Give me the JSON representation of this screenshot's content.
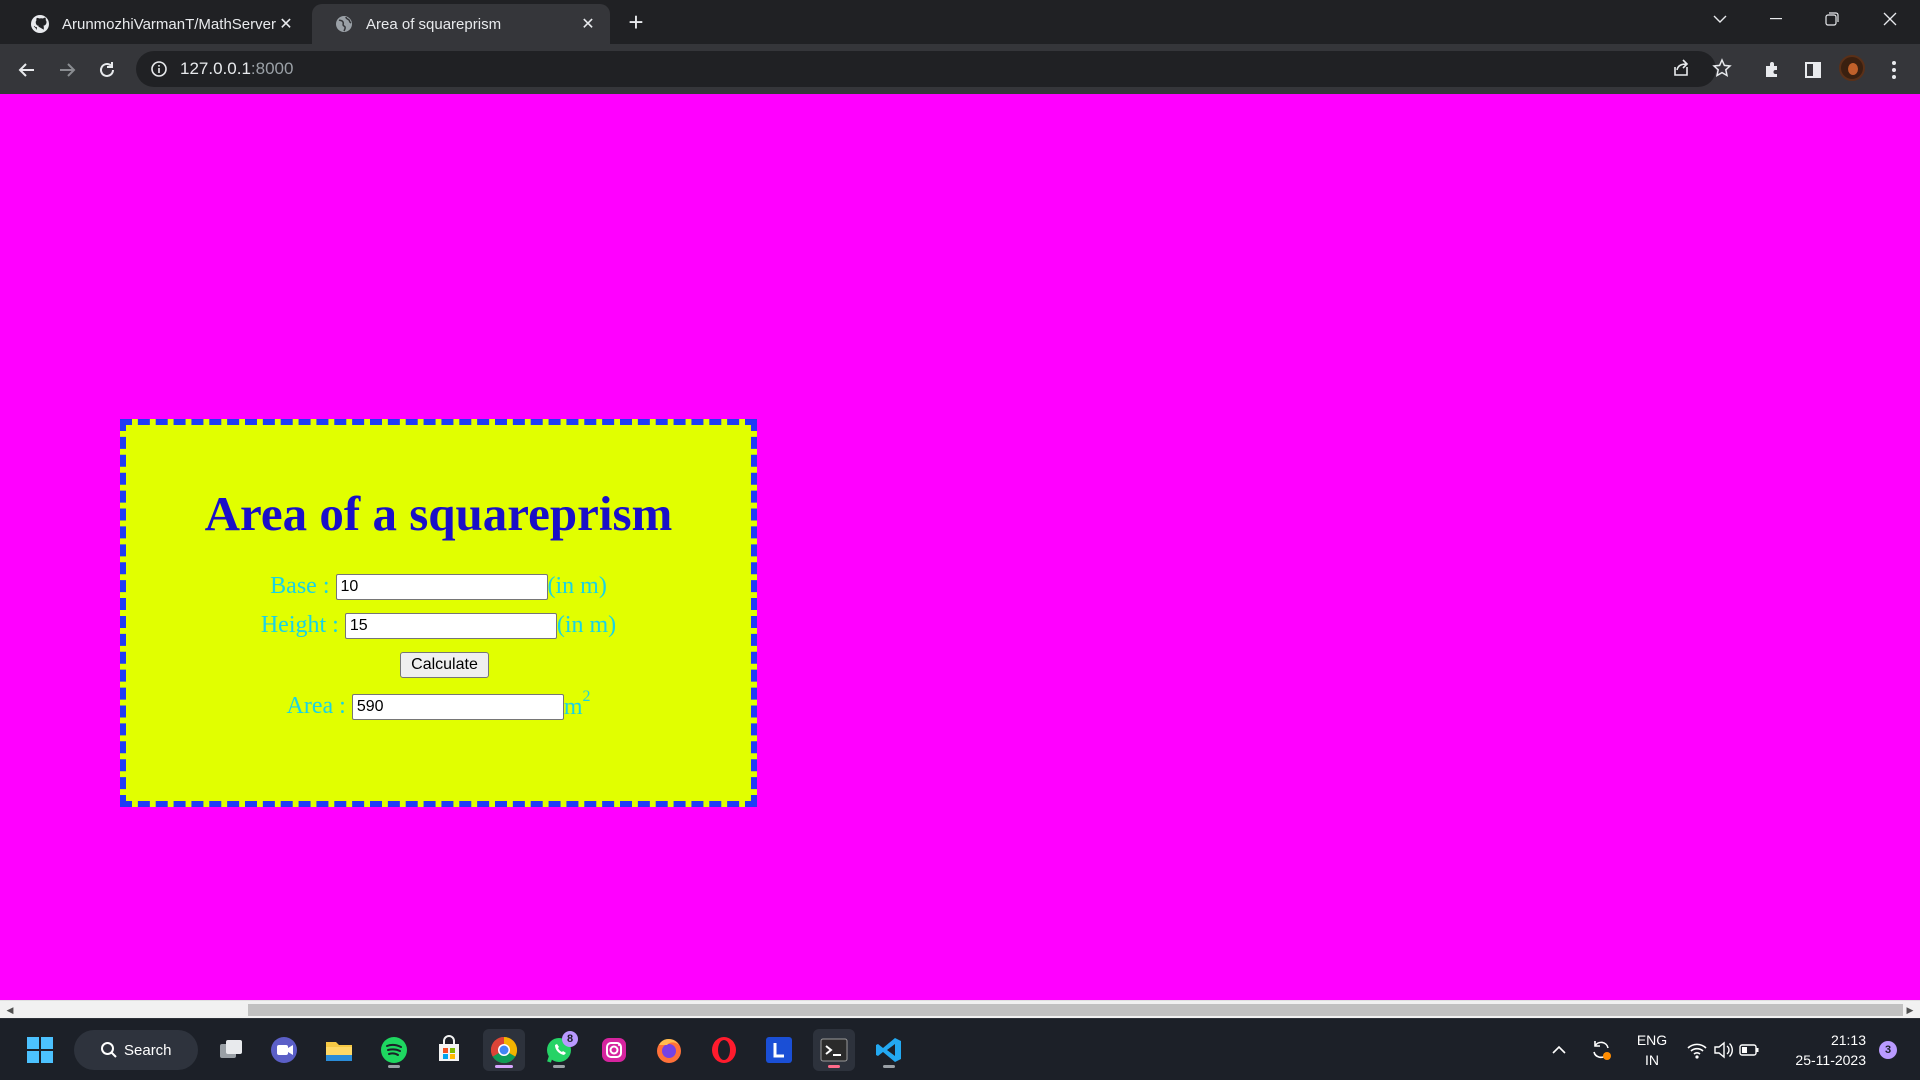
{
  "browser": {
    "tabs": [
      {
        "title": "ArunmozhiVarmanT/MathServer",
        "icon": "github-icon",
        "active": false
      },
      {
        "title": "Area of squareprism",
        "icon": "globe-icon",
        "active": true
      }
    ],
    "address": {
      "host": "127.0.0.1",
      "port": ":8000"
    }
  },
  "page": {
    "heading": "Area of a squareprism",
    "base": {
      "label": "Base :",
      "value": "10",
      "unit": "(in m)"
    },
    "height": {
      "label": "Height :",
      "value": "15",
      "unit": "(in m)"
    },
    "calculate_label": "Calculate",
    "area": {
      "label": "Area :",
      "value": "590",
      "unit": "m",
      "unit_sup": "2"
    },
    "colors": {
      "background": "#ff00ff",
      "card": "#e1ff00",
      "card_border": "#1f3cf5",
      "heading": "#1a0fc8",
      "label": "#19d3e6"
    }
  },
  "taskbar": {
    "search_label": "Search",
    "apps": [
      "start-icon",
      "task-view-icon",
      "teams-chat-icon",
      "file-explorer-icon",
      "spotify-icon",
      "microsoft-store-icon",
      "chrome-icon",
      "whatsapp-icon",
      "instagram-icon",
      "firefox-icon",
      "opera-icon",
      "l-app-icon",
      "terminal-icon",
      "vscode-icon"
    ],
    "whatsapp_badge": "8",
    "language": {
      "line1": "ENG",
      "line2": "IN"
    },
    "clock": {
      "time": "21:13",
      "date": "25-11-2023"
    },
    "notification_count": "3"
  }
}
